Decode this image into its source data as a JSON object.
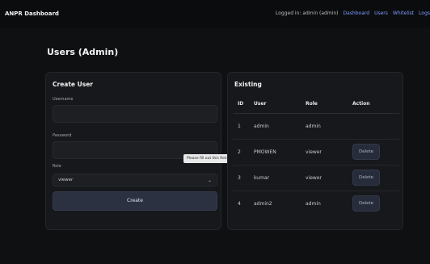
{
  "header": {
    "brand": "ANPR Dashboard",
    "logged_in": "Logged in: admin (admin)",
    "nav": [
      "Dashboard",
      "Users",
      "Whitelist",
      "Logs"
    ]
  },
  "page_title": "Users (Admin)",
  "create": {
    "title": "Create User",
    "username_label": "Username",
    "username_value": "",
    "password_label": "Password",
    "password_value": "",
    "role_label": "Role",
    "role_value": "viewer",
    "button": "Create",
    "tooltip": "Please fill out this field."
  },
  "existing": {
    "title": "Existing",
    "columns": [
      "ID",
      "User",
      "Role",
      "Action"
    ],
    "rows": [
      {
        "id": "1",
        "user": "admin",
        "role": "admin",
        "action": ""
      },
      {
        "id": "2",
        "user": "PMOWEN",
        "role": "viewer",
        "action": "Delete"
      },
      {
        "id": "3",
        "user": "kumar",
        "role": "viewer",
        "action": "Delete"
      },
      {
        "id": "4",
        "user": "admin2",
        "role": "admin",
        "action": "Delete"
      }
    ]
  },
  "colors": {
    "background": "#0f1012",
    "panel": "#17181b",
    "link": "#7f9cff",
    "button": "#2b3140"
  }
}
